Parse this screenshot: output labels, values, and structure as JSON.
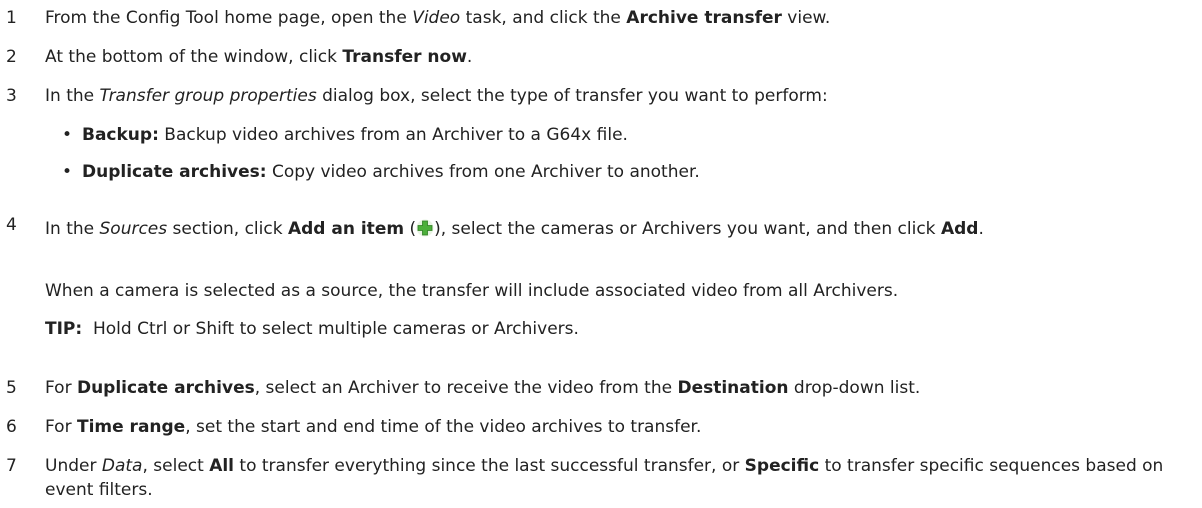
{
  "steps": [
    {
      "num": "1",
      "p1": "From the Config Tool home page, open the ",
      "italic1": "Video",
      "p2": " task, and click the ",
      "bold1": "Archive transfer",
      "p3": " view."
    },
    {
      "num": "2",
      "p1": "At the bottom of the window, click ",
      "bold1": "Transfer now",
      "p2": "."
    },
    {
      "num": "3",
      "p1": "In the ",
      "italic1": "Transfer group properties",
      "p2": " dialog box, select the type of transfer you want to perform:"
    },
    {
      "num": "4",
      "p1": "In the ",
      "italic1": "Sources",
      "p2": " section, click ",
      "bold1": "Add an item",
      "p3": " (",
      "p4": "), select the cameras or Archivers you want, and then click ",
      "bold2": "Add",
      "p5": "."
    },
    {
      "num": "5",
      "p1": "For ",
      "bold1": "Duplicate archives",
      "p2": ", select an Archiver to receive the video from the ",
      "bold2": "Destination",
      "p3": " drop-down list."
    },
    {
      "num": "6",
      "p1": "For ",
      "bold1": "Time range",
      "p2": ", set the start and end time of the video archives to transfer."
    },
    {
      "num": "7",
      "p1": "Under ",
      "italic1": "Data",
      "p2": ", select ",
      "bold1": "All",
      "p3": " to transfer everything since the last successful transfer, or ",
      "bold2": "Specific",
      "p4": " to transfer specific sequences based on event filters."
    }
  ],
  "bullets": [
    {
      "symbol": "•",
      "label": "Backup:",
      "text": " Backup video archives from an Archiver to a G64x file."
    },
    {
      "symbol": "•",
      "label": "Duplicate archives:",
      "text": " Copy video archives from one Archiver to another."
    }
  ],
  "note": "When a camera is selected as a source, the transfer will include associated video from all Archivers.",
  "tip": {
    "label": "TIP:",
    "text": "  Hold Ctrl or Shift to select multiple cameras or Archivers."
  },
  "icons": {
    "add_item": "plus-icon"
  },
  "colors": {
    "icon_green": "#4caf3a",
    "text": "#222222"
  }
}
